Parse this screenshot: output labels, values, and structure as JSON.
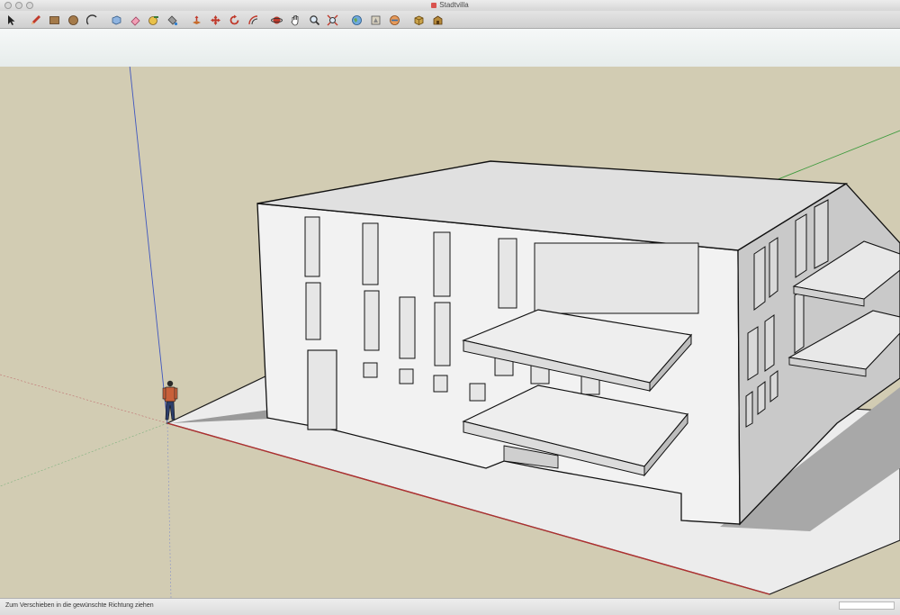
{
  "window": {
    "title": "Stadtvilla"
  },
  "toolbar": {
    "tools": [
      {
        "name": "select-tool",
        "icon": "arrow-icon"
      },
      {
        "name": "pencil-tool",
        "icon": "pencil-icon"
      },
      {
        "name": "rectangle-tool",
        "icon": "rectangle-icon"
      },
      {
        "name": "circle-tool",
        "icon": "circle-icon"
      },
      {
        "name": "arc-tool",
        "icon": "arc-icon"
      },
      {
        "name": "make-component-tool",
        "icon": "component-icon"
      },
      {
        "name": "eraser-tool",
        "icon": "eraser-icon"
      },
      {
        "name": "tape-measure-tool",
        "icon": "tape-measure-icon"
      },
      {
        "name": "paint-bucket-tool",
        "icon": "paint-bucket-icon"
      },
      {
        "name": "push-pull-tool",
        "icon": "push-pull-icon"
      },
      {
        "name": "move-tool",
        "icon": "move-icon"
      },
      {
        "name": "rotate-tool",
        "icon": "rotate-icon"
      },
      {
        "name": "offset-tool",
        "icon": "offset-icon"
      },
      {
        "name": "orbit-tool",
        "icon": "orbit-icon"
      },
      {
        "name": "pan-tool",
        "icon": "hand-icon"
      },
      {
        "name": "zoom-tool",
        "icon": "magnifier-icon"
      },
      {
        "name": "zoom-extents-tool",
        "icon": "zoom-extents-icon"
      },
      {
        "name": "get-models-tool",
        "icon": "globe-icon"
      },
      {
        "name": "share-model-tool",
        "icon": "share-icon"
      },
      {
        "name": "share-component-tool",
        "icon": "share-component-icon"
      },
      {
        "name": "components-tool",
        "icon": "box-icon"
      },
      {
        "name": "extension-warehouse-tool",
        "icon": "warehouse-icon"
      }
    ]
  },
  "status": {
    "text": "Zum Verschieben in die gewünschte Richtung ziehen",
    "measurement": ""
  },
  "colors": {
    "ground": "#d2ccb3",
    "sky": "#eef2f1",
    "axis_red": "#b03030",
    "axis_green": "#3c9a3c",
    "axis_blue": "#3f56c0"
  }
}
